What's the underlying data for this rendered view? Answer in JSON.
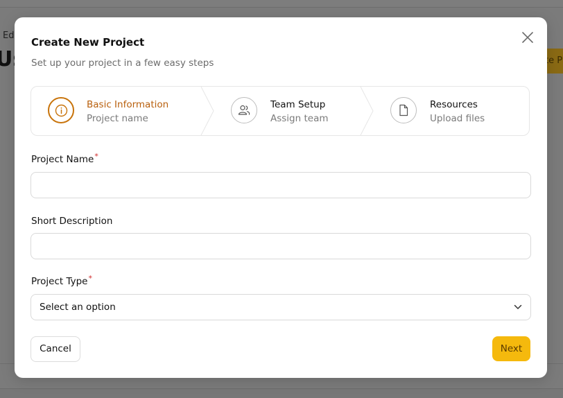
{
  "background": {
    "breadcrumb": "Ed",
    "title": "Us",
    "button_label": "te P"
  },
  "modal": {
    "title": "Create New Project",
    "subtitle": "Set up your project in a few easy steps",
    "close_icon": "close-icon",
    "accent_color": "#c8730a",
    "steps": [
      {
        "title": "Basic Information",
        "subtitle": "Project name",
        "icon": "info-icon",
        "active": true
      },
      {
        "title": "Team Setup",
        "subtitle": "Assign team",
        "icon": "users-icon",
        "active": false
      },
      {
        "title": "Resources",
        "subtitle": "Upload files",
        "icon": "file-icon",
        "active": false
      }
    ],
    "fields": {
      "project_name": {
        "label": "Project Name",
        "required_mark": "*",
        "value": ""
      },
      "short_description": {
        "label": "Short Description",
        "value": ""
      },
      "project_type": {
        "label": "Project Type",
        "required_mark": "*",
        "selected": "Select an option"
      }
    },
    "buttons": {
      "cancel": "Cancel",
      "next": "Next",
      "next_color": "#f5b90d"
    }
  }
}
